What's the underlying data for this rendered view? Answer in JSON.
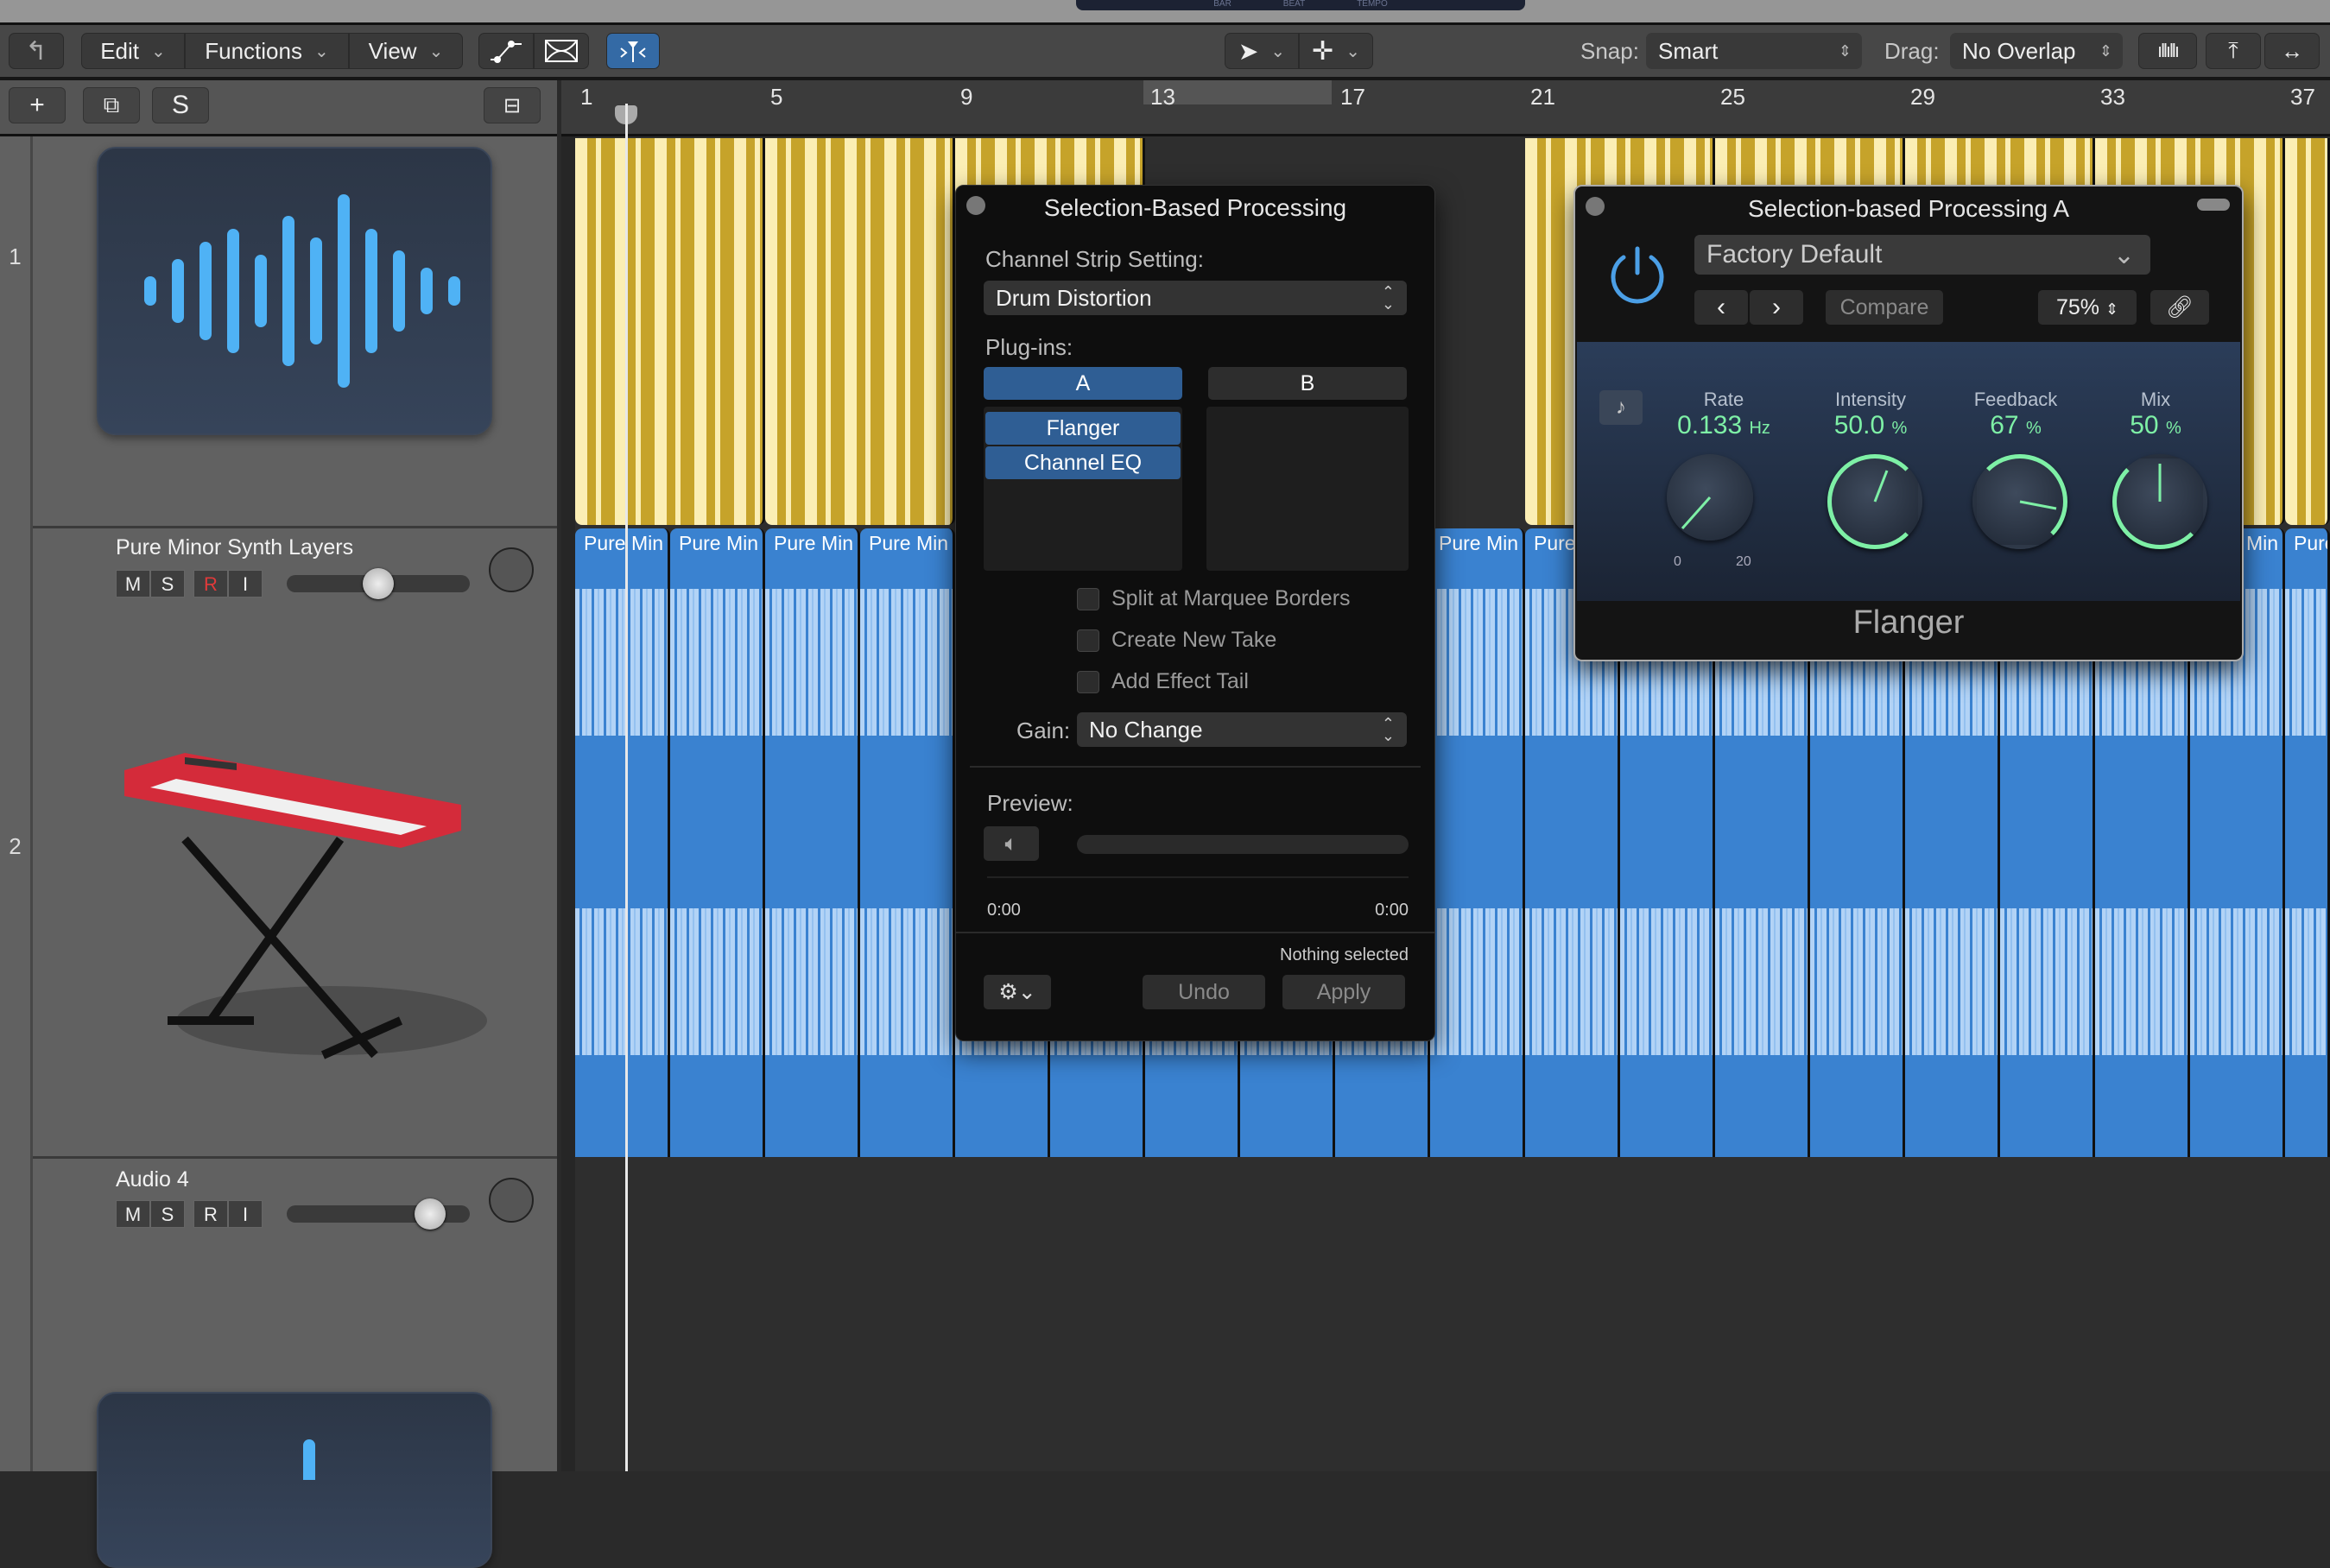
{
  "lcd": {
    "labels": [
      "BAR",
      "BEAT",
      "TEMPO"
    ]
  },
  "toolbar": {
    "back_icon": "back-arrow-icon",
    "menus": [
      {
        "label": "Edit"
      },
      {
        "label": "Functions"
      },
      {
        "label": "View"
      }
    ],
    "automation_icon": "automation-curve-icon",
    "flex_icon": "flex-waveform-icon",
    "catch_icon": "catch-playhead-icon",
    "pointer_tool": "pointer-icon",
    "marquee_tool": "crosshair-icon",
    "snap_label": "Snap:",
    "snap_value": "Smart",
    "drag_label": "Drag:",
    "drag_value": "No Overlap",
    "right_icons": [
      "waveform-zoom-icon",
      "vertical-zoom-icon",
      "horizontal-zoom-icon"
    ]
  },
  "track_header_bar": {
    "add_label": "+",
    "duplicate_icon": "duplicate-track-icon",
    "s_label": "S",
    "collapse_icon": "collapse-icon"
  },
  "ruler": {
    "bars": [
      "1",
      "5",
      "9",
      "13",
      "17",
      "21",
      "25",
      "29",
      "33",
      "37"
    ]
  },
  "tracks": [
    {
      "number": "1",
      "name": "",
      "icon": "waveform-icon"
    },
    {
      "number": "2",
      "name": "Pure Minor Synth Layers",
      "icon": "keyboard-synth-icon",
      "buttons": [
        "M",
        "S",
        "R",
        "I"
      ],
      "volume": 0.5
    },
    {
      "number": "",
      "name": "Audio 4",
      "icon": "waveform-icon",
      "buttons": [
        "M",
        "S",
        "R",
        "I"
      ],
      "volume": 0.72
    }
  ],
  "regions": {
    "blue_label": "Pure Min",
    "blue_label_short": "Pure"
  },
  "sbp_panel": {
    "title": "Selection-Based Processing",
    "channel_strip_label": "Channel Strip Setting:",
    "channel_strip_value": "Drum Distortion",
    "plugins_label": "Plug-ins:",
    "tab_a": "A",
    "tab_b": "B",
    "slots_a": [
      "Flanger",
      "Channel EQ"
    ],
    "options": [
      {
        "label": "Split at Marquee Borders",
        "checked": false
      },
      {
        "label": "Create New Take",
        "checked": false
      },
      {
        "label": "Add Effect Tail",
        "checked": false
      }
    ],
    "gain_label": "Gain:",
    "gain_value": "No Change",
    "preview_label": "Preview:",
    "time_start": "0:00",
    "time_end": "0:00",
    "status": "Nothing selected",
    "undo_label": "Undo",
    "apply_label": "Apply"
  },
  "plugin_window": {
    "title": "Selection-based Processing A",
    "preset": "Factory Default",
    "compare_label": "Compare",
    "zoom_value": "75%",
    "plugin_name": "Flanger",
    "params": [
      {
        "name": "Rate",
        "value": "0.133",
        "unit": "Hz",
        "min": "0",
        "max": "20"
      },
      {
        "name": "Intensity",
        "value": "50.0",
        "unit": "%"
      },
      {
        "name": "Feedback",
        "value": "67",
        "unit": "%"
      },
      {
        "name": "Mix",
        "value": "50",
        "unit": "%"
      }
    ]
  }
}
